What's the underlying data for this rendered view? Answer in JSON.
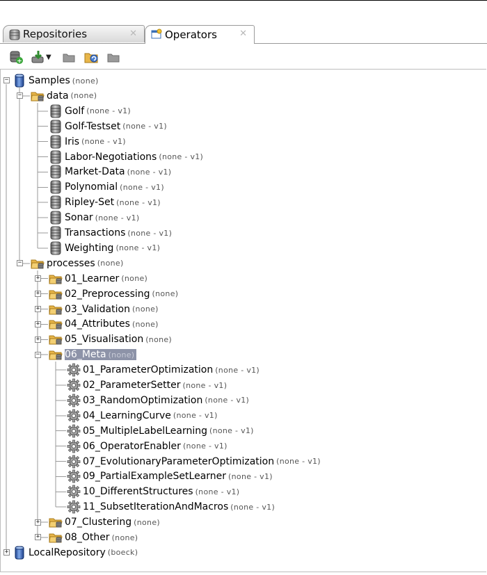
{
  "tabs": [
    {
      "label": "Repositories",
      "icon": "database-icon",
      "active": false
    },
    {
      "label": "Operators",
      "icon": "operators-window-icon",
      "active": true
    }
  ],
  "toolbar": {
    "buttons": [
      "add-repository-icon",
      "import-dropdown-icon",
      "open-icon",
      "refresh-icon",
      "delete-icon"
    ]
  },
  "tree": [
    {
      "label": "Samples",
      "meta": "(none)",
      "icon": "repository",
      "level": 0,
      "expanded": true
    },
    {
      "label": "data",
      "meta": "(none)",
      "icon": "folder",
      "level": 1,
      "expanded": true
    },
    {
      "label": "Golf",
      "meta": "(none - v1)",
      "icon": "data",
      "level": 2
    },
    {
      "label": "Golf-Testset",
      "meta": "(none - v1)",
      "icon": "data",
      "level": 2
    },
    {
      "label": "Iris",
      "meta": "(none - v1)",
      "icon": "data",
      "level": 2
    },
    {
      "label": "Labor-Negotiations",
      "meta": "(none - v1)",
      "icon": "data",
      "level": 2
    },
    {
      "label": "Market-Data",
      "meta": "(none - v1)",
      "icon": "data",
      "level": 2
    },
    {
      "label": "Polynomial",
      "meta": "(none - v1)",
      "icon": "data",
      "level": 2
    },
    {
      "label": "Ripley-Set",
      "meta": "(none - v1)",
      "icon": "data",
      "level": 2
    },
    {
      "label": "Sonar",
      "meta": "(none - v1)",
      "icon": "data",
      "level": 2
    },
    {
      "label": "Transactions",
      "meta": "(none - v1)",
      "icon": "data",
      "level": 2
    },
    {
      "label": "Weighting",
      "meta": "(none - v1)",
      "icon": "data",
      "level": 2
    },
    {
      "label": "processes",
      "meta": "(none)",
      "icon": "folder",
      "level": 1,
      "expanded": true
    },
    {
      "label": "01_Learner",
      "meta": "(none)",
      "icon": "folder",
      "level": 2,
      "expanded": false
    },
    {
      "label": "02_Preprocessing",
      "meta": "(none)",
      "icon": "folder",
      "level": 2,
      "expanded": false
    },
    {
      "label": "03_Validation",
      "meta": "(none)",
      "icon": "folder",
      "level": 2,
      "expanded": false
    },
    {
      "label": "04_Attributes",
      "meta": "(none)",
      "icon": "folder",
      "level": 2,
      "expanded": false
    },
    {
      "label": "05_Visualisation",
      "meta": "(none)",
      "icon": "folder",
      "level": 2,
      "expanded": false
    },
    {
      "label": "06_Meta",
      "meta": "(none)",
      "icon": "folder",
      "level": 2,
      "expanded": true,
      "selected": true
    },
    {
      "label": "01_ParameterOptimization",
      "meta": "(none - v1)",
      "icon": "process",
      "level": 3
    },
    {
      "label": "02_ParameterSetter",
      "meta": "(none - v1)",
      "icon": "process",
      "level": 3
    },
    {
      "label": "03_RandomOptimization",
      "meta": "(none - v1)",
      "icon": "process",
      "level": 3
    },
    {
      "label": "04_LearningCurve",
      "meta": "(none - v1)",
      "icon": "process",
      "level": 3
    },
    {
      "label": "05_MultipleLabelLearning",
      "meta": "(none - v1)",
      "icon": "process",
      "level": 3
    },
    {
      "label": "06_OperatorEnabler",
      "meta": "(none - v1)",
      "icon": "process",
      "level": 3
    },
    {
      "label": "07_EvolutionaryParameterOptimization",
      "meta": "(none - v1)",
      "icon": "process",
      "level": 3
    },
    {
      "label": "09_PartialExampleSetLearner",
      "meta": "(none - v1)",
      "icon": "process",
      "level": 3
    },
    {
      "label": "10_DifferentStructures",
      "meta": "(none - v1)",
      "icon": "process",
      "level": 3
    },
    {
      "label": "11_SubsetIterationAndMacros",
      "meta": "(none - v1)",
      "icon": "process",
      "level": 3
    },
    {
      "label": "07_Clustering",
      "meta": "(none)",
      "icon": "folder",
      "level": 2,
      "expanded": false
    },
    {
      "label": "08_Other",
      "meta": "(none)",
      "icon": "folder",
      "level": 2,
      "expanded": false
    },
    {
      "label": "LocalRepository",
      "meta": "(boeck)",
      "icon": "repository",
      "level": 0,
      "expanded": false
    }
  ],
  "colors": {
    "selection": "#8d93a8",
    "folder": "#e8b64a"
  }
}
